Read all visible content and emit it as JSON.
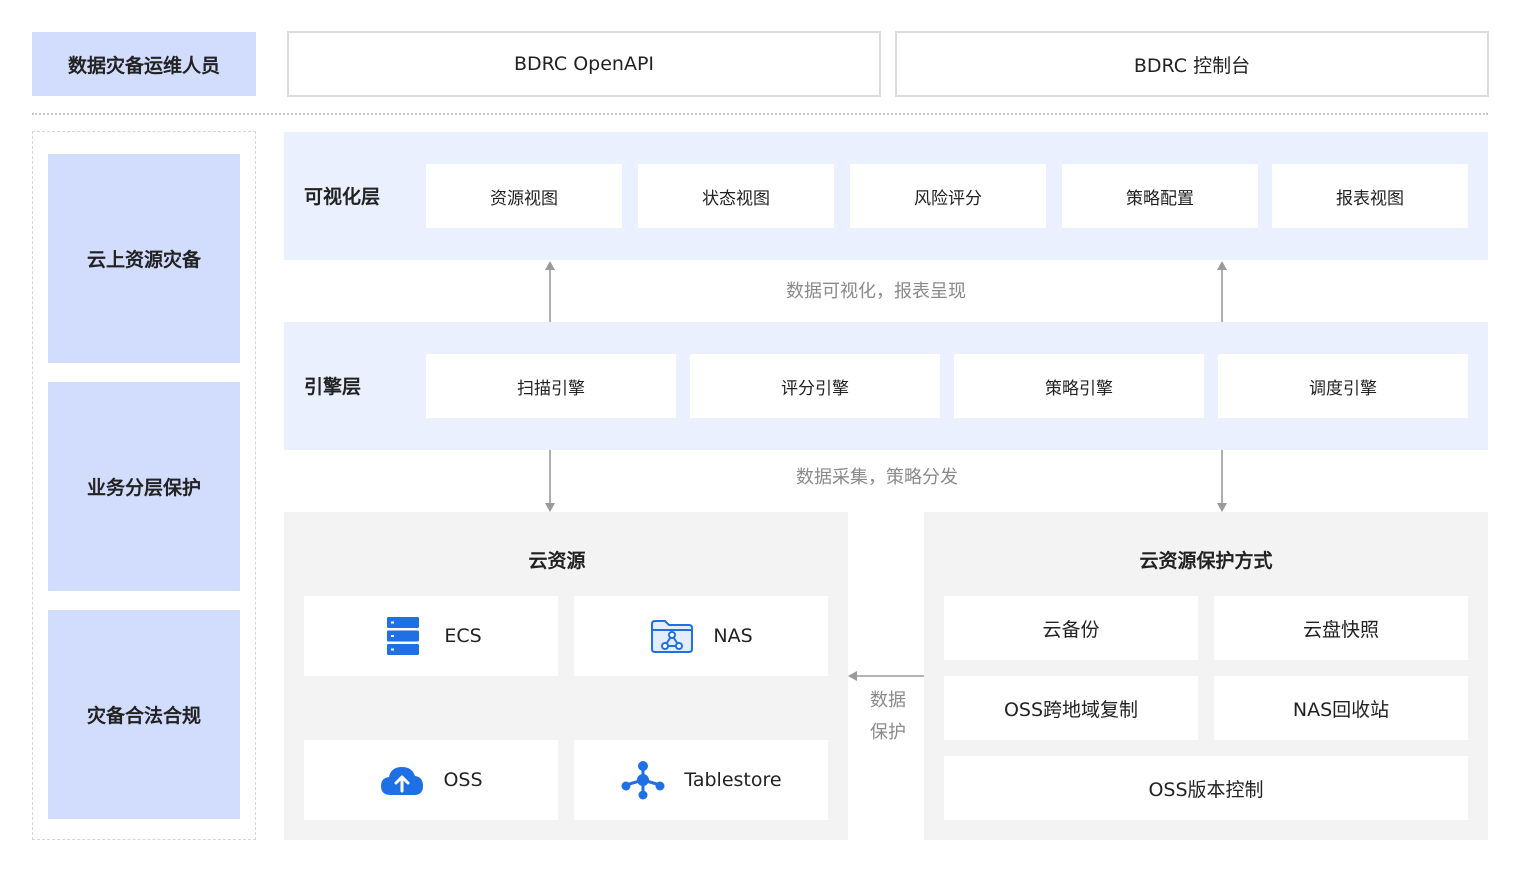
{
  "header": {
    "role": "数据灾备运维人员",
    "openapi": "BDRC OpenAPI",
    "console": "BDRC 控制台"
  },
  "left_items": [
    "云上资源灾备",
    "业务分层保护",
    "灾备合法合规"
  ],
  "visual_layer": {
    "title": "可视化层",
    "items": [
      "资源视图",
      "状态视图",
      "风险评分",
      "策略配置",
      "报表视图"
    ]
  },
  "caption_up": "数据可视化，报表呈现",
  "engine_layer": {
    "title": "引擎层",
    "items": [
      "扫描引擎",
      "评分引擎",
      "策略引擎",
      "调度引擎"
    ]
  },
  "caption_down": "数据采集，策略分发",
  "resources": {
    "title": "云资源",
    "items": [
      {
        "label": "ECS",
        "icon": "server-stack-icon"
      },
      {
        "label": "NAS",
        "icon": "folder-network-icon"
      },
      {
        "label": "OSS",
        "icon": "cloud-upload-icon"
      },
      {
        "label": "Tablestore",
        "icon": "node-graph-icon"
      }
    ]
  },
  "protection_caption_line1": "数据",
  "protection_caption_line2": "保护",
  "protection": {
    "title": "云资源保护方式",
    "items": [
      "云备份",
      "云盘快照",
      "OSS跨地域复制",
      "NAS回收站",
      "OSS版本控制"
    ]
  },
  "colors": {
    "accent": "#1f6fe5",
    "layer_bg": "#eaf0fe",
    "role_bg": "#d2dcfd",
    "panel_bg": "#f3f3f3",
    "arrow": "#9a9a9a"
  }
}
